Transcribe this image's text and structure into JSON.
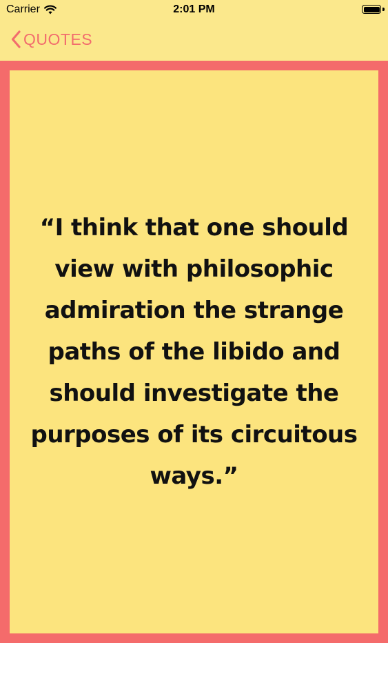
{
  "status_bar": {
    "carrier": "Carrier",
    "time": "2:01 PM",
    "wifi_icon": "wifi-icon",
    "battery_icon": "battery-icon",
    "battery_level": 1.0
  },
  "nav": {
    "back_label": "QUOTES",
    "back_icon": "chevron-left-icon"
  },
  "quote": {
    "text": "“I think that one should view with philosophic admiration the strange paths of the libido and should investigate the purposes of its circuitous ways.”"
  },
  "colors": {
    "header_bg": "#fbe88c",
    "accent": "#f26d6d",
    "frame": "#f46b6b",
    "card_bg": "#fce47e",
    "text": "#111111"
  }
}
